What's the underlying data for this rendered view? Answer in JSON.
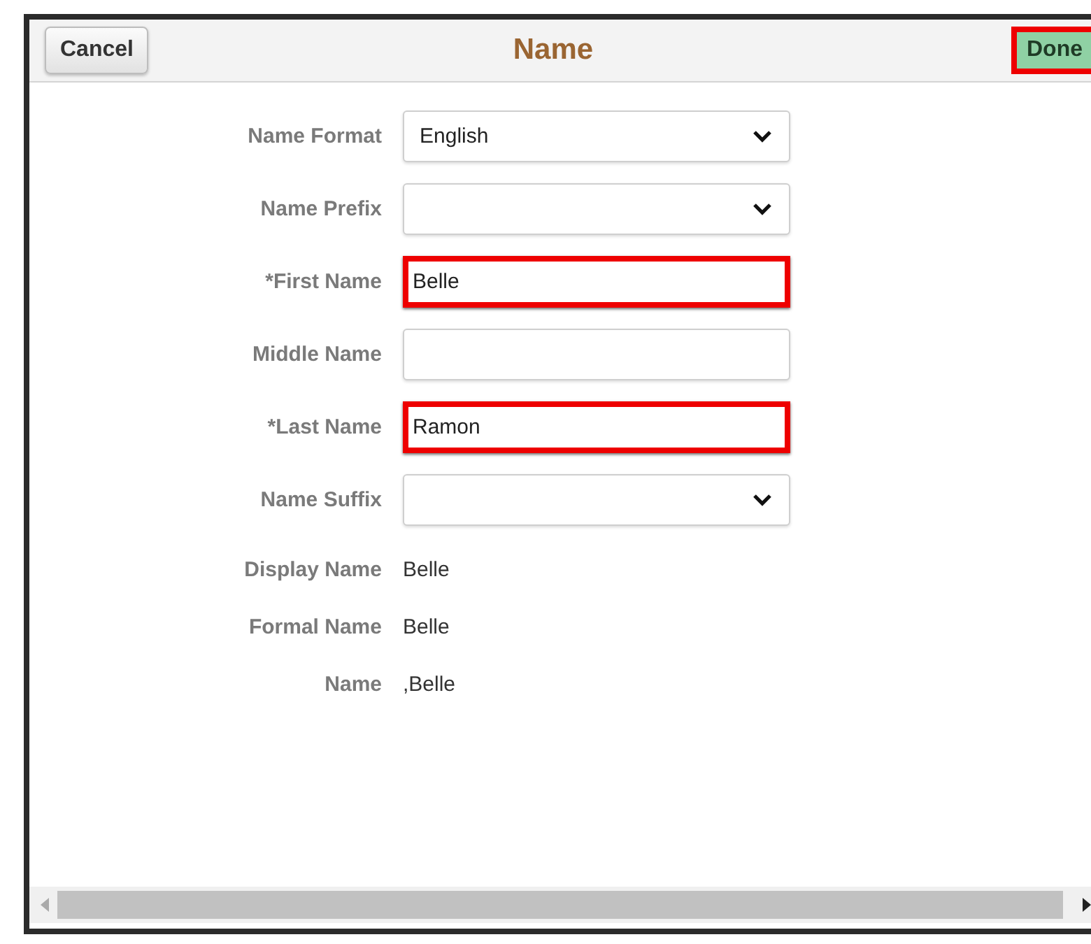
{
  "header": {
    "cancel": "Cancel",
    "title": "Name",
    "done": "Done",
    "done_highlighted": true
  },
  "fields": [
    {
      "label": "Name Format",
      "kind": "select",
      "value": "English",
      "highlighted": false
    },
    {
      "label": "Name Prefix",
      "kind": "select",
      "highlighted": false
    },
    {
      "label": "*First Name",
      "kind": "text",
      "value": "Belle",
      "highlighted": true
    },
    {
      "label": "Middle Name",
      "kind": "text",
      "highlighted": false
    },
    {
      "label": "*Last Name",
      "kind": "text",
      "value": "Ramon",
      "highlighted": true
    },
    {
      "label": "Name Suffix",
      "kind": "select",
      "highlighted": false
    }
  ],
  "display": [
    {
      "label": "Display Name",
      "value": "Belle"
    },
    {
      "label": "Formal Name",
      "value": "Belle"
    },
    {
      "label": "Name",
      "value": ",Belle"
    }
  ]
}
